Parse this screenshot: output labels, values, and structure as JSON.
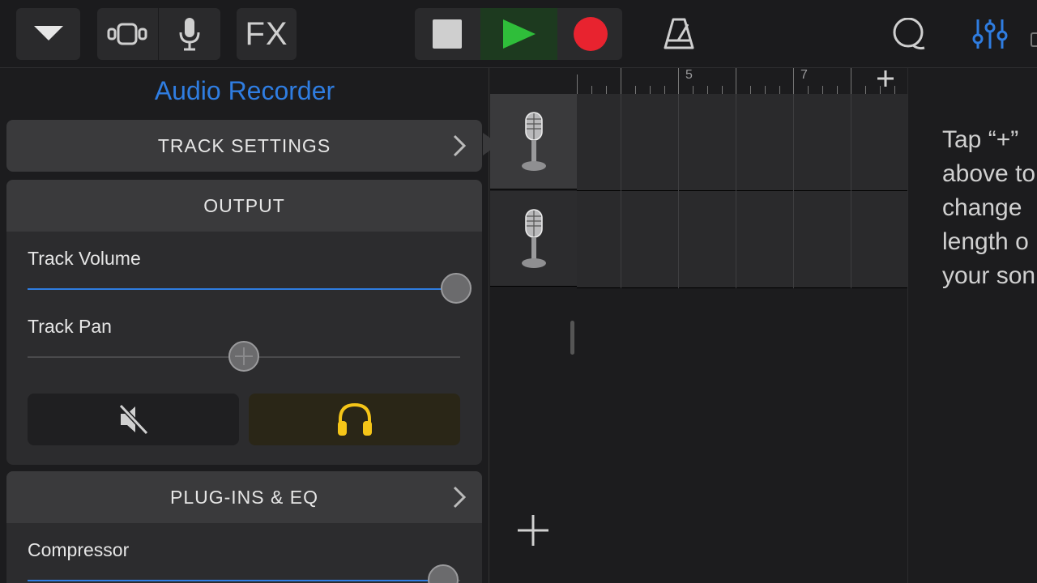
{
  "toolbar": {
    "fx_label": "FX",
    "icons": [
      "dropdown-icon",
      "tracks-view-icon",
      "microphone-icon",
      "stop-icon",
      "play-icon",
      "record-icon",
      "metronome-icon",
      "loop-icon",
      "mixer-settings-icon"
    ],
    "colors": {
      "play": "#2fbe3a",
      "record": "#e8232f",
      "mixer": "#2f7de1"
    }
  },
  "panel": {
    "title": "Audio Recorder",
    "track_settings": "TRACK SETTINGS",
    "output": {
      "heading": "OUTPUT",
      "track_volume_label": "Track Volume",
      "track_volume_level": 0.99,
      "track_pan_label": "Track Pan",
      "track_pan_level": 0.5,
      "mute_icon": "speaker-muted-icon",
      "solo_icon": "headphones-icon",
      "solo_color": "#f5c518"
    },
    "plugins": {
      "heading": "PLUG-INS & EQ",
      "compressor_label": "Compressor",
      "compressor_level": 0.96
    }
  },
  "tracks": {
    "items": [
      {
        "icon": "microphone-icon",
        "selected": true
      },
      {
        "icon": "microphone-icon",
        "selected": false
      }
    ],
    "add_track_icon": "plus-icon"
  },
  "ruler": {
    "bar_numbers": [
      "5",
      "7"
    ],
    "add_section_icon": "plus-icon"
  },
  "hint": {
    "lines": [
      "Tap “+”",
      "above to",
      "change",
      "length o",
      "your son"
    ]
  }
}
